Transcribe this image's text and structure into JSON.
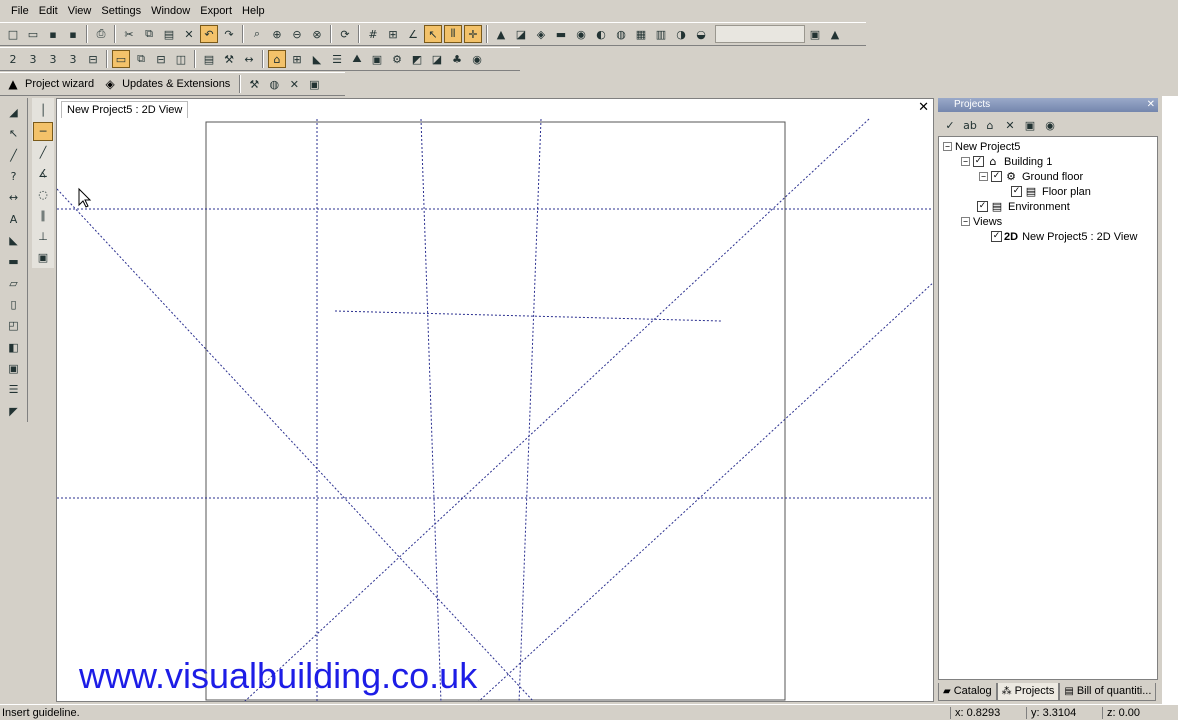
{
  "menu": [
    "File",
    "Edit",
    "View",
    "Settings",
    "Window",
    "Export",
    "Help"
  ],
  "toolbar3": {
    "project_wizard": "Project wizard",
    "updates": "Updates & Extensions"
  },
  "document": {
    "tab_title": "New Project5 : 2D View",
    "watermark": "www.visualbuilding.co.uk"
  },
  "project_panel": {
    "title": "Projects",
    "tree": {
      "root": "New Project5",
      "building": "Building 1",
      "ground_floor": "Ground floor",
      "floor_plan": "Floor plan",
      "environment": "Environment",
      "views": "Views",
      "view_2d_prefix": "2D",
      "view_2d": "New Project5 : 2D View"
    },
    "tabs": [
      "Catalog",
      "Projects",
      "Bill of quantiti..."
    ]
  },
  "status": {
    "message": "Insert guideline.",
    "x": "x: 0.8293",
    "y": "y: 3.3104",
    "z": "z: 0.00"
  },
  "colors": {
    "guideline": "#2a2f8f",
    "active_tool": "#f3c26a",
    "watermark": "#1d1de6"
  }
}
